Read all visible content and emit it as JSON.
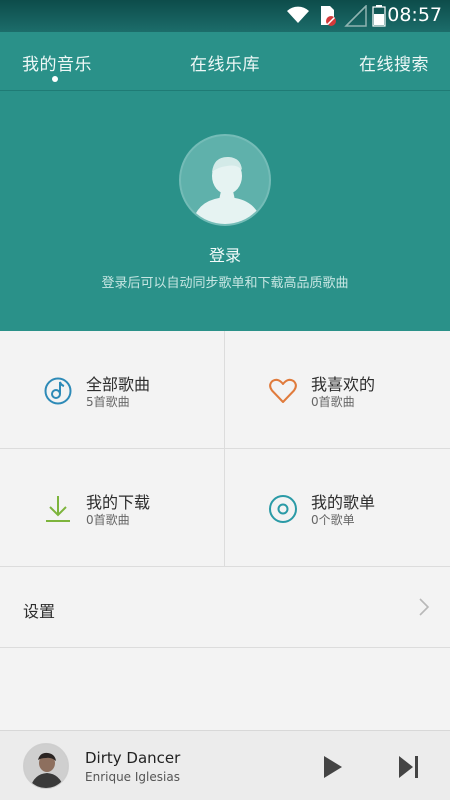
{
  "status_bar": {
    "time": "08:57",
    "icons": [
      "wifi-icon",
      "sim-blocked-icon",
      "signal-icon",
      "battery-icon"
    ]
  },
  "tabs": [
    {
      "label": "我的音乐",
      "active": true
    },
    {
      "label": "在线乐库",
      "active": false
    },
    {
      "label": "在线搜索",
      "active": false
    }
  ],
  "profile": {
    "login_label": "登录",
    "login_hint": "登录后可以自动同步歌单和下载高品质歌曲"
  },
  "grid": [
    {
      "title": "全部歌曲",
      "subtitle": "5首歌曲",
      "icon": "music-note-icon",
      "color": "#2d8ab7"
    },
    {
      "title": "我喜欢的",
      "subtitle": "0首歌曲",
      "icon": "heart-icon",
      "color": "#e07b3c"
    },
    {
      "title": "我的下载",
      "subtitle": "0首歌曲",
      "icon": "download-icon",
      "color": "#7db43c"
    },
    {
      "title": "我的歌单",
      "subtitle": "0个歌单",
      "icon": "playlist-disc-icon",
      "color": "#2a9aa6"
    }
  ],
  "settings": {
    "label": "设置"
  },
  "player": {
    "title": "Dirty Dancer",
    "artist": "Enrique Iglesias"
  },
  "colors": {
    "header": "#2a9189",
    "background": "#f3f3f3"
  }
}
